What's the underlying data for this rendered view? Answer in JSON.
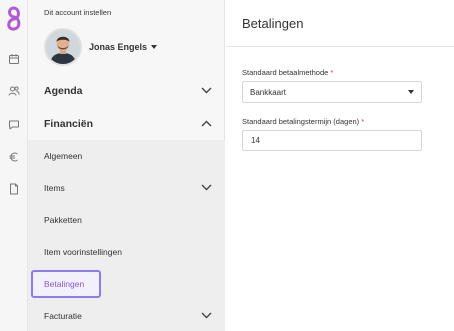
{
  "rail": {
    "icons": [
      "logo-icon",
      "calendar-icon",
      "users-icon",
      "chat-icon",
      "euro-icon",
      "document-icon"
    ],
    "logo_color": "#b25ad6"
  },
  "account": {
    "header": "Dit account instellen",
    "user_name": "Jonas Engels"
  },
  "sidebar": {
    "agenda": "Agenda",
    "financien": "Financiën",
    "items": [
      {
        "label": "Algemeen"
      },
      {
        "label": "Items"
      },
      {
        "label": "Pakketten"
      },
      {
        "label": "Item voorinstellingen"
      },
      {
        "label": "Betalingen"
      },
      {
        "label": "Facturatie"
      }
    ]
  },
  "main": {
    "title": "Betalingen",
    "method_label": "Standaard betaalmethode",
    "method_value": "Bankkaart",
    "term_label": "Standaard betalingstermijn (dagen)",
    "term_value": "14",
    "required_marker": "*"
  },
  "colors": {
    "accent": "#8d7bf0",
    "active_text": "#8a58c8",
    "required": "#e03a3a"
  }
}
